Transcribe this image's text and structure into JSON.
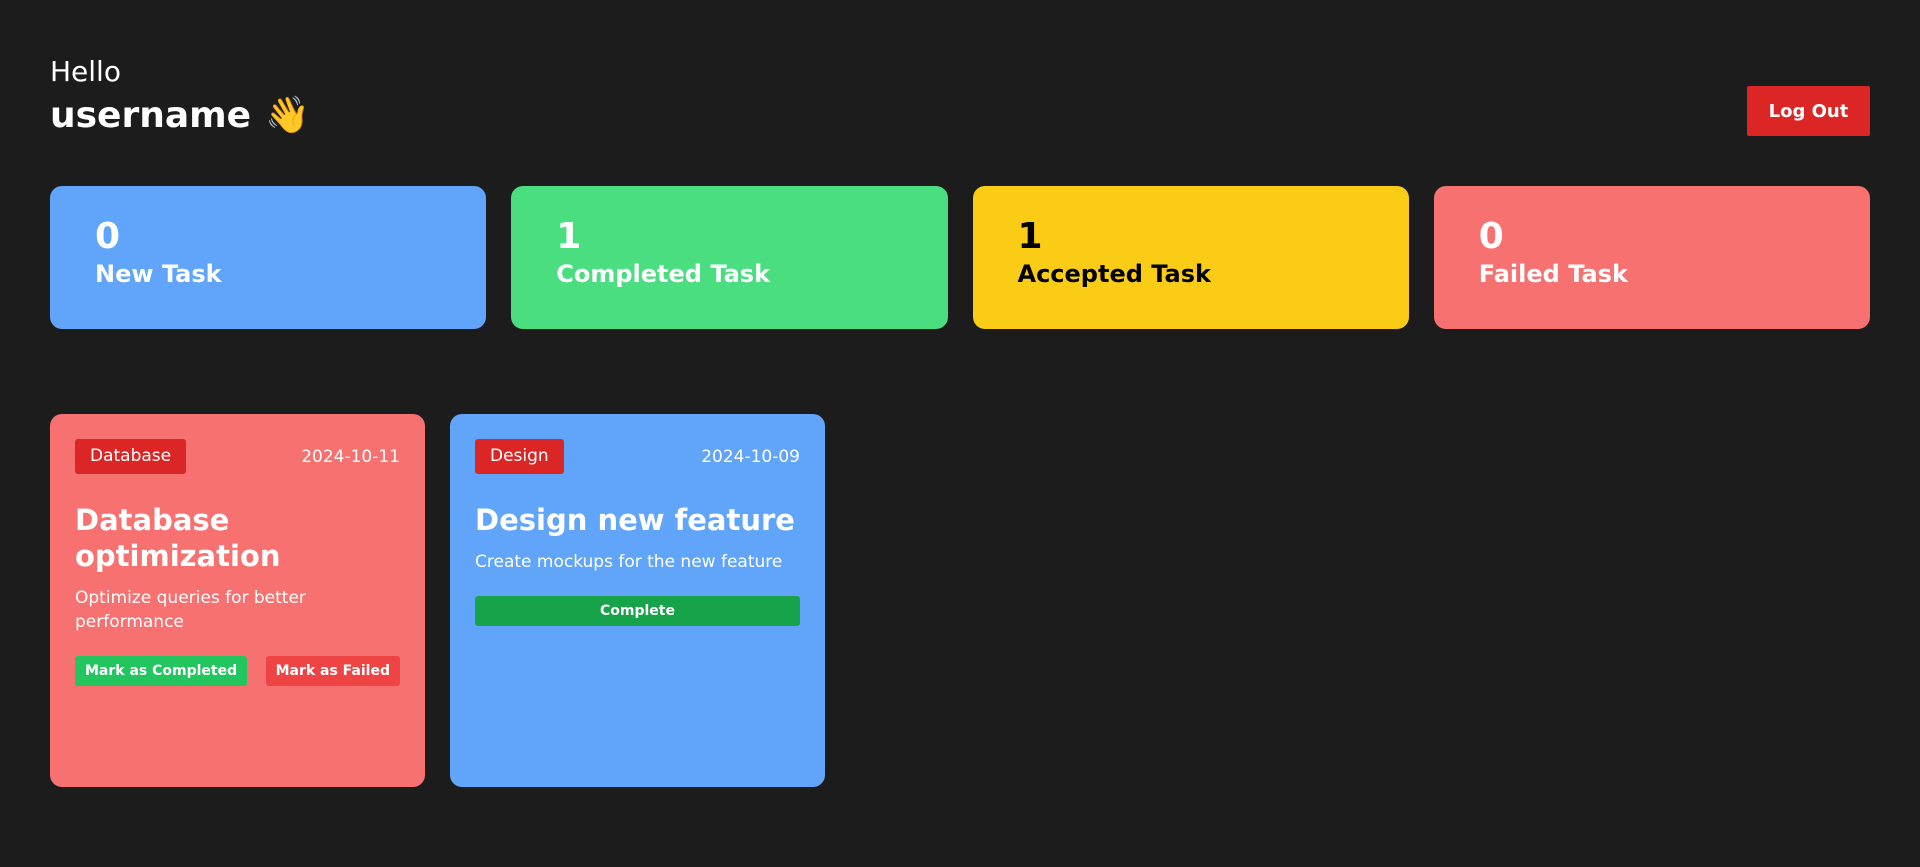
{
  "header": {
    "hello": "Hello",
    "username": "username",
    "wave_emoji": "👋",
    "logout_label": "Log Out"
  },
  "stats": [
    {
      "count": "0",
      "label": "New Task",
      "color": "#60a5fa",
      "text_color": "#ffffff"
    },
    {
      "count": "1",
      "label": "Completed Task",
      "color": "#4ade80",
      "text_color": "#ffffff"
    },
    {
      "count": "1",
      "label": "Accepted Task",
      "color": "#facc15",
      "text_color": "#000000"
    },
    {
      "count": "0",
      "label": "Failed Task",
      "color": "#f87171",
      "text_color": "#ffffff"
    }
  ],
  "tasks": [
    {
      "category": "Database",
      "date": "2024-10-11",
      "title": "Database optimization",
      "description": "Optimize queries for better performance",
      "color": "#f87171",
      "actions": {
        "mark_completed": "Mark as Completed",
        "mark_failed": "Mark as Failed"
      }
    },
    {
      "category": "Design",
      "date": "2024-10-09",
      "title": "Design new feature",
      "description": "Create mockups for the new feature",
      "color": "#60a5fa",
      "actions": {
        "complete": "Complete"
      }
    }
  ],
  "colors": {
    "background": "#1c1c1c",
    "danger": "#dc2626",
    "success": "#22c55e"
  }
}
